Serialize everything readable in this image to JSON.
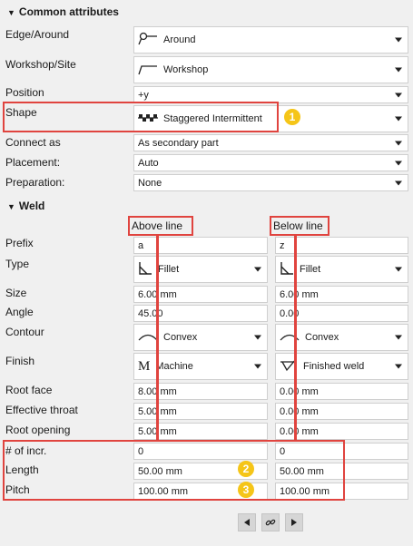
{
  "sections": {
    "common": "Common attributes",
    "weld": "Weld"
  },
  "common": {
    "edge_label": "Edge/Around",
    "edge_value": "Around",
    "workshop_label": "Workshop/Site",
    "workshop_value": "Workshop",
    "position_label": "Position",
    "position_value": "+y",
    "shape_label": "Shape",
    "shape_value": "Staggered Intermittent",
    "connect_label": "Connect as",
    "connect_value": "As secondary part",
    "placement_label": "Placement:",
    "placement_value": "Auto",
    "prep_label": "Preparation:",
    "prep_value": "None"
  },
  "weld": {
    "above_header": "Above line",
    "below_header": "Below line",
    "rows": {
      "prefix": {
        "label": "Prefix",
        "above": "a",
        "below": "z"
      },
      "type": {
        "label": "Type",
        "above": "Fillet",
        "below": "Fillet"
      },
      "size": {
        "label": "Size",
        "above": "6.00 mm",
        "below": "6.00 mm"
      },
      "angle": {
        "label": "Angle",
        "above": "45.00",
        "below": "0.00"
      },
      "contour": {
        "label": "Contour",
        "above": "Convex",
        "below": "Convex"
      },
      "finish": {
        "label": "Finish",
        "above": "Machine",
        "below": "Finished weld",
        "above_icon_text": "M"
      },
      "root_face": {
        "label": "Root face",
        "above": "8.00 mm",
        "below": "0.00 mm"
      },
      "throat": {
        "label": "Effective throat",
        "above": "5.00 mm",
        "below": "0.00 mm"
      },
      "root_opening": {
        "label": "Root opening",
        "above": "5.00 mm",
        "below": "0.00 mm"
      },
      "incr": {
        "label": "# of incr.",
        "above": "0",
        "below": "0"
      },
      "length": {
        "label": "Length",
        "above": "50.00 mm",
        "below": "50.00 mm"
      },
      "pitch": {
        "label": "Pitch",
        "above": "100.00 mm",
        "below": "100.00 mm"
      }
    }
  },
  "badges": {
    "b1": "1",
    "b2": "2",
    "b3": "3"
  },
  "colors": {
    "highlight": "#e0443f",
    "badge": "#f5c518"
  }
}
